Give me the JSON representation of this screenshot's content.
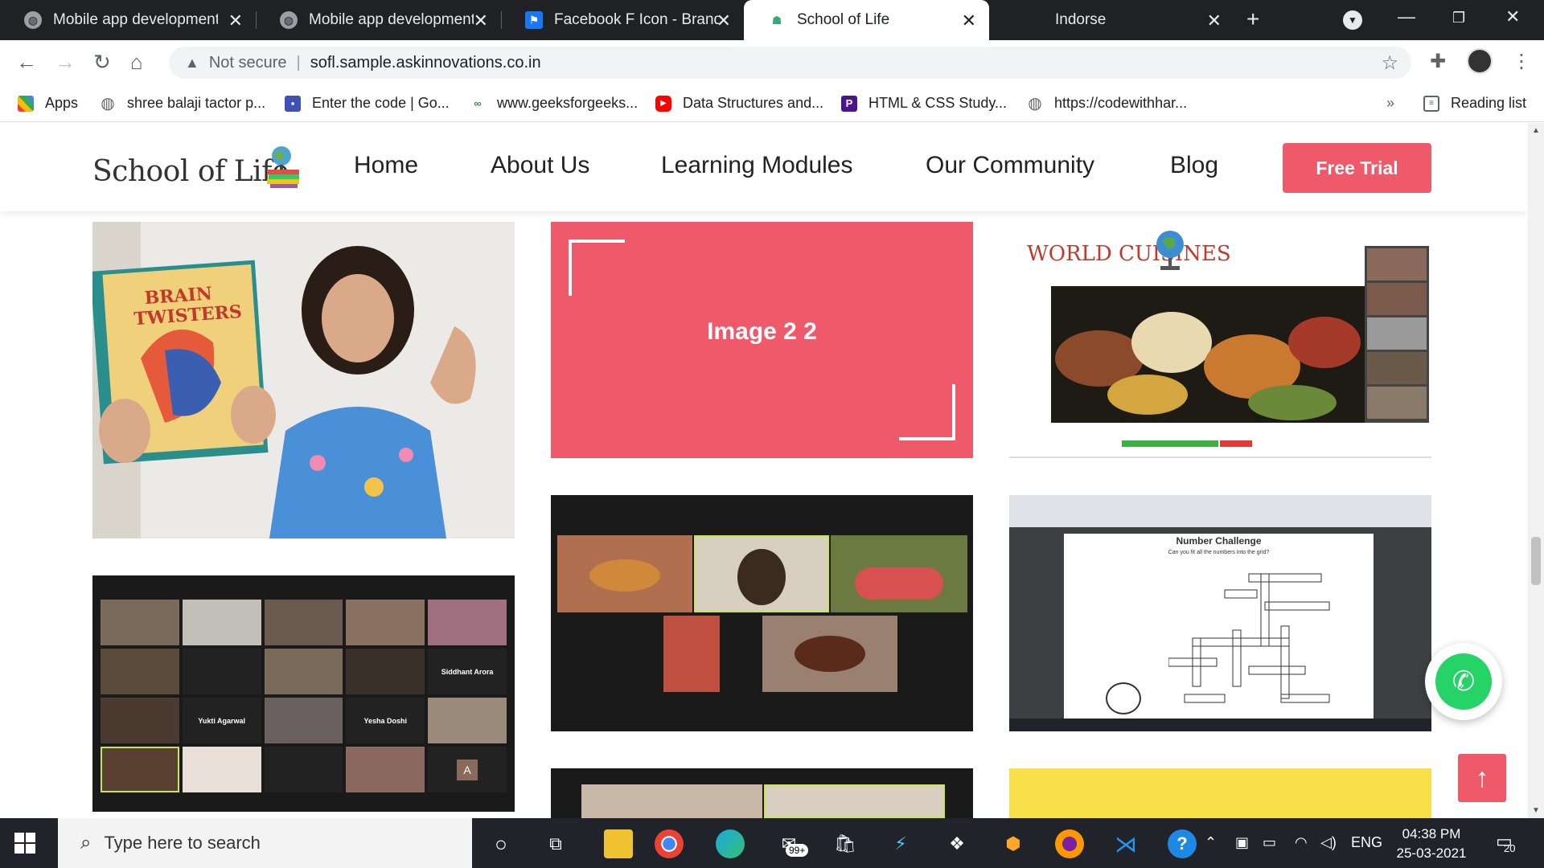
{
  "tabs": [
    {
      "label": "Mobile app development",
      "icon": "globe-icon"
    },
    {
      "label": "Mobile app development",
      "icon": "globe-icon"
    },
    {
      "label": "Facebook F Icon - Brands",
      "icon": "flag-icon"
    },
    {
      "label": "School of Life",
      "icon": "site-favicon"
    },
    {
      "label": "Indorse",
      "icon": "none"
    }
  ],
  "omnibox": {
    "security": "Not secure",
    "url": "sofl.sample.askinnovations.co.in"
  },
  "bookmarks": [
    {
      "label": "Apps"
    },
    {
      "label": "shree balaji tactor p..."
    },
    {
      "label": "Enter the code | Go..."
    },
    {
      "label": "www.geeksforgeeks..."
    },
    {
      "label": "Data Structures and..."
    },
    {
      "label": "HTML & CSS Study..."
    },
    {
      "label": "https://codewithhar..."
    }
  ],
  "reading_list": "Reading list",
  "site": {
    "logo": "School of Life",
    "nav": [
      "Home",
      "About Us",
      "Learning Modules",
      "Our Community",
      "Blog"
    ],
    "cta": "Free Trial"
  },
  "gallery": {
    "placeholder_label": "Image 2 2",
    "world_cuisines_title": "WORLD CUISINES",
    "number_challenge_title": "Number Challenge",
    "number_challenge_q": "Can you fit all the numbers into the grid?",
    "zoom_names": [
      "Siddhant Arora",
      "Yukti Agarwal",
      "Yesha Doshi",
      "A"
    ]
  },
  "taskbar": {
    "search_placeholder": "Type here to search",
    "time": "04:38 PM",
    "date": "25-03-2021",
    "lang": "ENG",
    "mail_badge": "99+",
    "notif_count": "20"
  },
  "colors": {
    "brand": "#ef5a6a",
    "whatsapp": "#25d366"
  }
}
